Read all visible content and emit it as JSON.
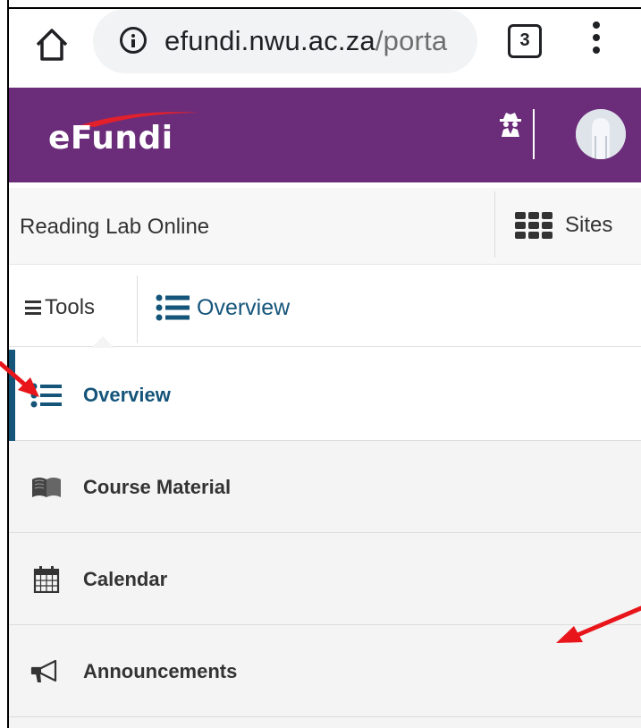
{
  "browser": {
    "url_main": "efundi.nwu.ac.za",
    "url_path": "/porta",
    "tab_count": "3"
  },
  "header": {
    "logo_text": "eFundi",
    "brand_color": "#6b2d7a"
  },
  "site_bar": {
    "title": "Reading Lab Online",
    "sites_label": "Sites"
  },
  "tools_bar": {
    "tools_label": "Tools",
    "current_tool": "Overview",
    "accent_color": "#15557a"
  },
  "tools": [
    {
      "label": "Overview",
      "icon": "list-icon",
      "active": true
    },
    {
      "label": "Course Material",
      "icon": "book-icon",
      "active": false
    },
    {
      "label": "Calendar",
      "icon": "calendar-icon",
      "active": false
    },
    {
      "label": "Announcements",
      "icon": "megaphone-icon",
      "active": false
    }
  ]
}
